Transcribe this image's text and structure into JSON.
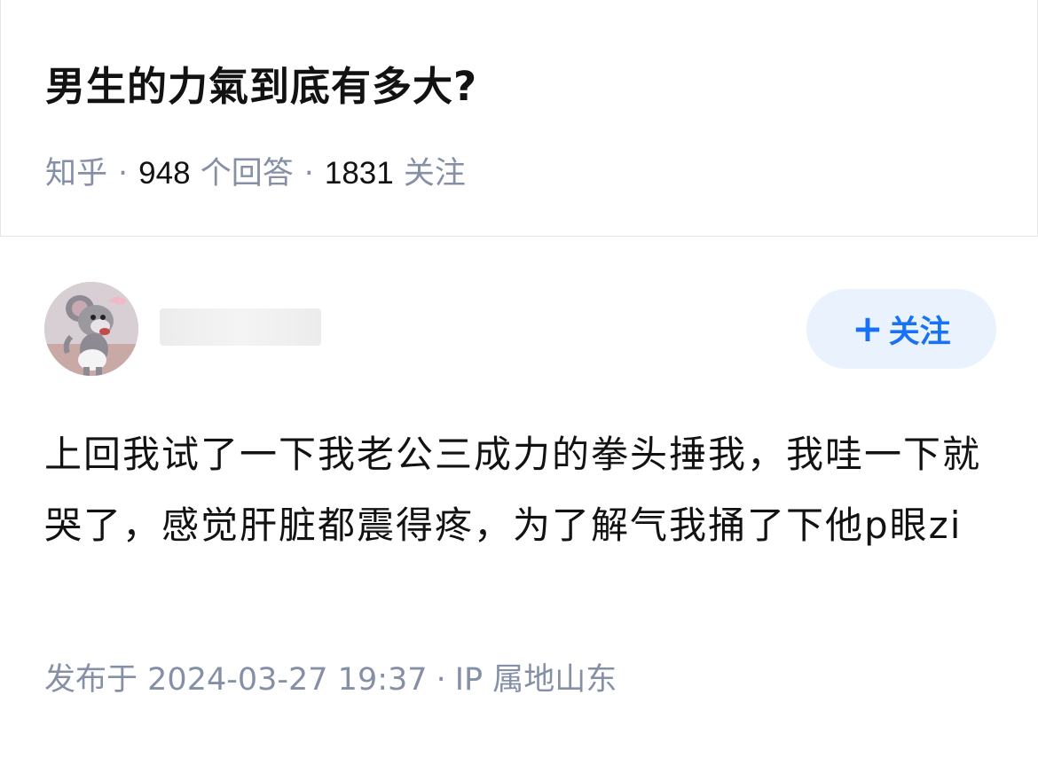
{
  "question": {
    "title": "男生的力氣到底有多大?",
    "source": "知乎",
    "answer_count": "948",
    "answer_label": "个回答",
    "follow_count": "1831",
    "follow_label": "关注"
  },
  "answer": {
    "follow_button_label": "关注",
    "content": "上回我试了一下我老公三成力的拳头捶我，我哇一下就哭了，感觉肝脏都震得疼，为了解气我捅了下他p眼zi",
    "published_prefix": "发布于",
    "published_time": "2024-03-27 19:37",
    "ip_label": "IP 属地山东"
  },
  "colors": {
    "primary_text": "#121212",
    "secondary_text": "#8590a6",
    "accent": "#1772f6",
    "follow_button_bg": "#eaf2fd"
  },
  "icons": {
    "follow_plus": "plus-icon",
    "avatar": "cartoon-mouse-avatar"
  }
}
